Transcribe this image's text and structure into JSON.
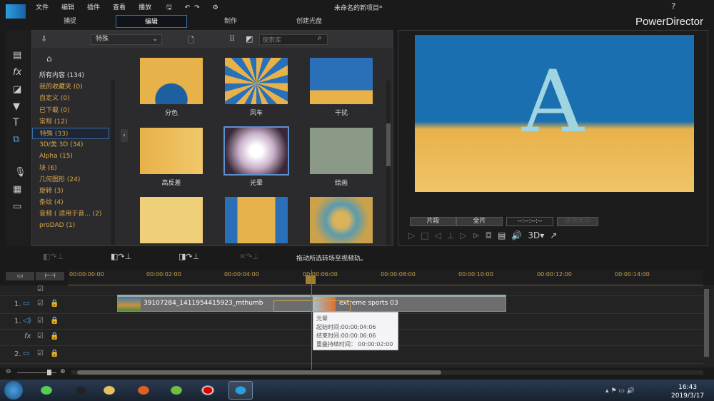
{
  "menu": [
    "文件",
    "编辑",
    "插件",
    "查看",
    "播放"
  ],
  "project_title": "未命名的新项目*",
  "brand": "PowerDirector",
  "help": "?",
  "tabs": [
    "捕捉",
    "编辑",
    "制作",
    "创建光盘"
  ],
  "library": {
    "dropdown": "特殊",
    "search_placeholder": "搜索库",
    "categories": [
      "所有内容 (134)",
      "我的收藏夹 (0)",
      "自定义 (0)",
      "已下载 (0)",
      "常规 (12)",
      "特殊 (33)",
      "3D/类 3D (34)",
      "Alpha (15)",
      "块 (6)",
      "几何图形 (24)",
      "旋转 (3)",
      "条纹 (4)",
      "音频 ( 适用于音... (2)",
      "proDAD (1)"
    ],
    "items": [
      "分色",
      "风车",
      "干扰",
      "高反差",
      "光晕",
      "绘画",
      "",
      "",
      ""
    ]
  },
  "preview": {
    "clip_btn": "片段",
    "movie_btn": "全片",
    "timecode": "--:--:--:--",
    "fit": "适合大小",
    "mode3d": "3D"
  },
  "timeline": {
    "hint": "拖动所选转场至视频轨。",
    "ticks": [
      "00:00:00:00",
      "00:00:02:00",
      "00:00:04:00",
      "00:00:06:00",
      "00:00:08:00",
      "00:00:10:00",
      "00:00:12:00",
      "00:00:14:00"
    ],
    "tracks": [
      "1.",
      "1.",
      "",
      "2."
    ],
    "clip1": "39107284_1411954415923_mthumb",
    "clip2": "extreme sports 03",
    "tooltip": {
      "name": "光晕",
      "start": "起始时间:00:00:04:06",
      "end": "结束时间:00:00:06:06",
      "overlap": "重叠持续时间： 00:00:02:00"
    }
  },
  "taskbar": {
    "time": "16:43",
    "date": "2019/3/17"
  },
  "colors": {
    "accent": "#3b6fa8",
    "gold": "#d8a64a"
  }
}
